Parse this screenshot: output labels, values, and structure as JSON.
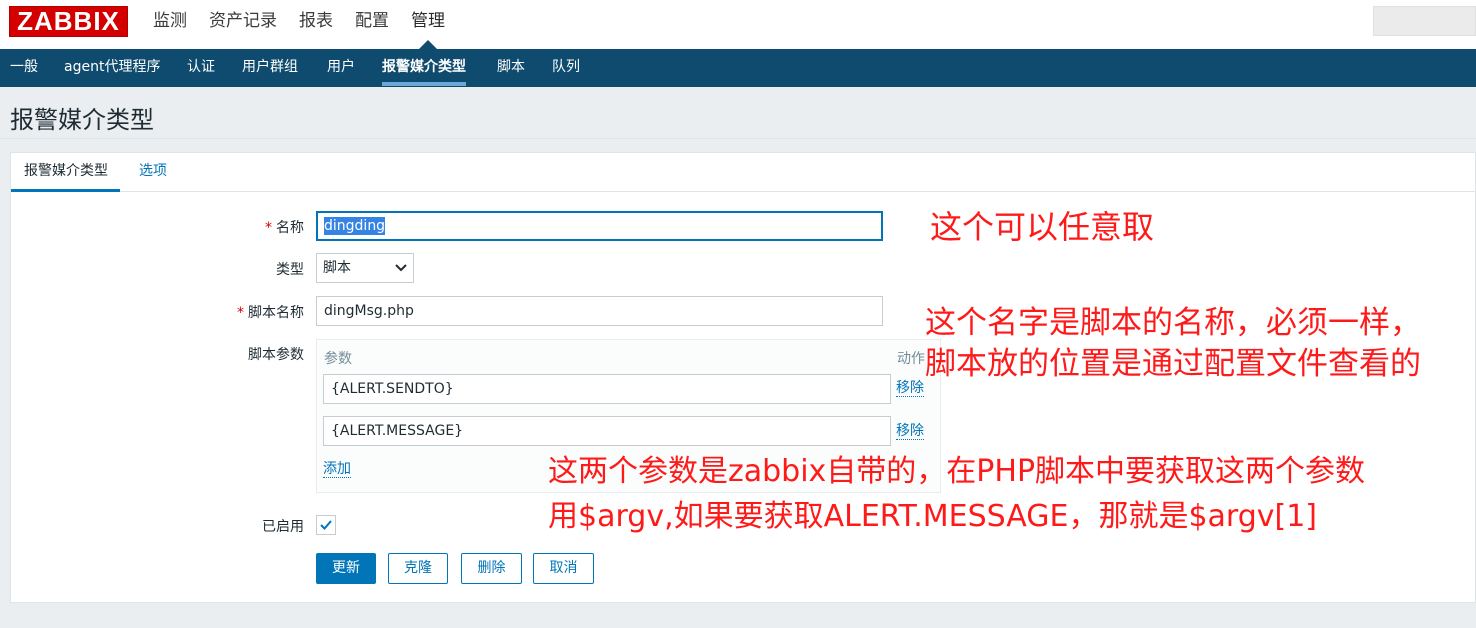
{
  "logo": "ZABBIX",
  "main_menu": [
    "监测",
    "资产记录",
    "报表",
    "配置",
    "管理"
  ],
  "sub_menu": [
    "一般",
    "agent代理程序",
    "认证",
    "用户群组",
    "用户",
    "报警媒介类型",
    "脚本",
    "队列"
  ],
  "page_title": "报警媒介类型",
  "tabs": [
    "报警媒介类型",
    "选项"
  ],
  "form": {
    "name_label": "名称",
    "name_value": "dingding",
    "type_label": "类型",
    "type_value": "脚本",
    "script_name_label": "脚本名称",
    "script_name_value": "dingMsg.php",
    "params_label": "脚本参数",
    "params_col_param": "参数",
    "params_col_action": "动作",
    "params": [
      {
        "value": "{ALERT.SENDTO}",
        "remove": "移除"
      },
      {
        "value": "{ALERT.MESSAGE}",
        "remove": "移除"
      }
    ],
    "add_label": "添加",
    "enabled_label": "已启用",
    "enabled": true,
    "required_mark": "*"
  },
  "buttons": {
    "update": "更新",
    "clone": "克隆",
    "delete": "删除",
    "cancel": "取消"
  },
  "annotations": {
    "name_note": "这个可以任意取",
    "script_note_1": "这个名字是脚本的名称，必须一样，",
    "script_note_2": "脚本放的位置是通过配置文件查看的",
    "params_note_1": "这两个参数是zabbix自带的，在PHP脚本中要获取这两个参数",
    "params_note_2": "用$argv,如果要获取ALERT.MESSAGE，那就是$argv[1]"
  },
  "colors": {
    "brand_red": "#d40000",
    "nav_blue": "#0f4b6e",
    "link_blue": "#0275b8",
    "annotation_red": "#ff1a1a"
  }
}
